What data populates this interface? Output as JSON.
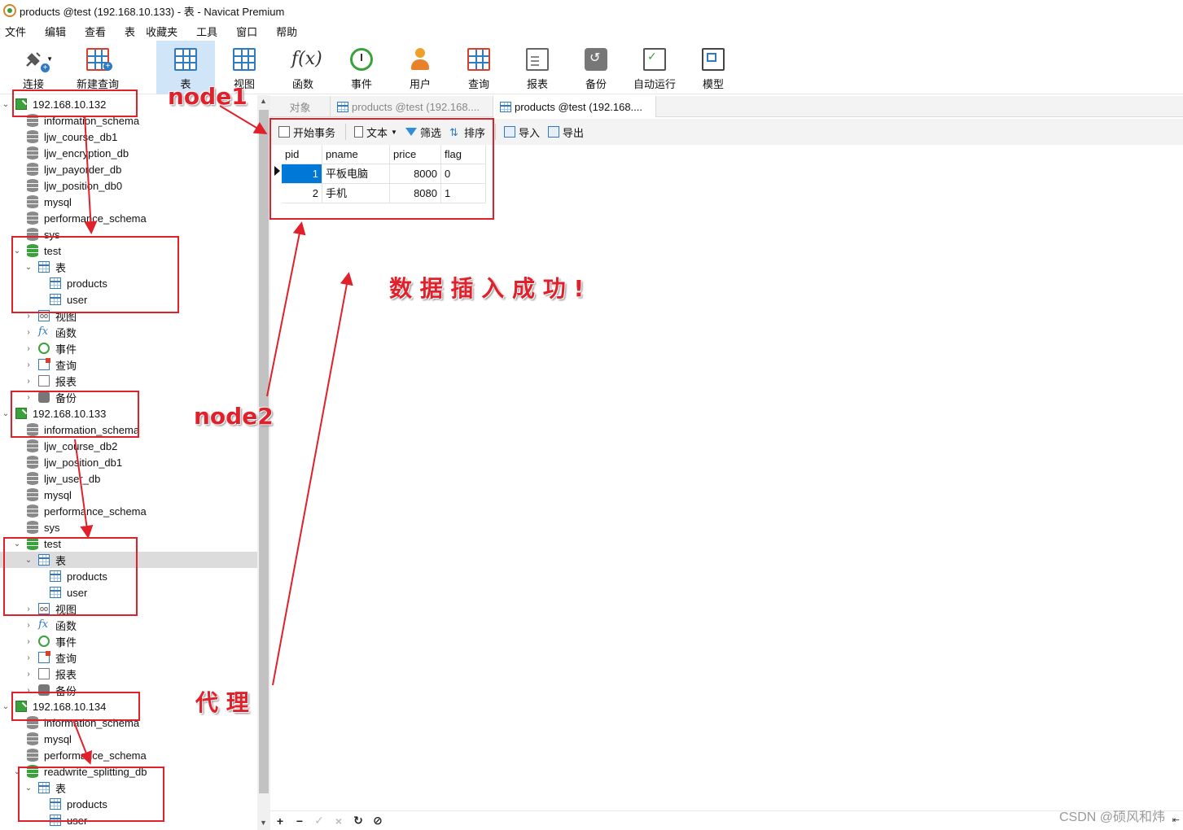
{
  "window": {
    "title": "products @test (192.168.10.133) - 表 - Navicat Premium"
  },
  "menu": [
    "文件",
    "编辑",
    "查看",
    "表",
    "收藏夹",
    "工具",
    "窗口",
    "帮助"
  ],
  "toolbar": {
    "connect": "连接",
    "new_query": "新建查询",
    "table": "表",
    "view": "视图",
    "function": "函数",
    "event": "事件",
    "user": "用户",
    "query": "查询",
    "report": "报表",
    "backup": "备份",
    "automation": "自动运行",
    "model": "模型"
  },
  "tree": {
    "node1": {
      "host": "192.168.10.132",
      "dbs": [
        "information_schema",
        "ljw_course_db1",
        "ljw_encryption_db",
        "ljw_payorder_db",
        "ljw_position_db0",
        "mysql",
        "performance_schema",
        "sys"
      ],
      "open_db": "test",
      "tables_label": "表",
      "tables": [
        "products",
        "user"
      ],
      "groups": [
        "视图",
        "函数",
        "事件",
        "查询",
        "报表",
        "备份"
      ]
    },
    "node2": {
      "host": "192.168.10.133",
      "dbs": [
        "information_schema",
        "ljw_course_db2",
        "ljw_position_db1",
        "ljw_user_db",
        "mysql",
        "performance_schema",
        "sys"
      ],
      "open_db": "test",
      "tables_label": "表",
      "tables": [
        "products",
        "user"
      ],
      "groups": [
        "视图",
        "函数",
        "事件",
        "查询",
        "报表",
        "备份"
      ]
    },
    "proxy": {
      "host": "192.168.10.134",
      "dbs": [
        "information_schema",
        "mysql",
        "performance_schema"
      ],
      "open_db": "readwrite_splitting_db",
      "tables_label": "表",
      "tables": [
        "products",
        "user"
      ]
    }
  },
  "tabs": {
    "objects": "对象",
    "tab1": "products @test (192.168....",
    "tab2": "products @test (192.168...."
  },
  "subtoolbar": {
    "begin_tx": "开始事务",
    "text": "文本",
    "filter": "筛选",
    "sort": "排序",
    "import": "导入",
    "export": "导出"
  },
  "grid": {
    "columns": [
      "pid",
      "pname",
      "price",
      "flag"
    ],
    "rows": [
      [
        "1",
        "平板电脑",
        "8000",
        "0"
      ],
      [
        "2",
        "手机",
        "8080",
        "1"
      ]
    ]
  },
  "annotations": {
    "node1": "node1",
    "node2": "node2",
    "proxy": "代 理",
    "success": "数 据 插 入 成 功 !",
    "color": "#e0202a"
  },
  "watermark": "CSDN @硕风和炜"
}
